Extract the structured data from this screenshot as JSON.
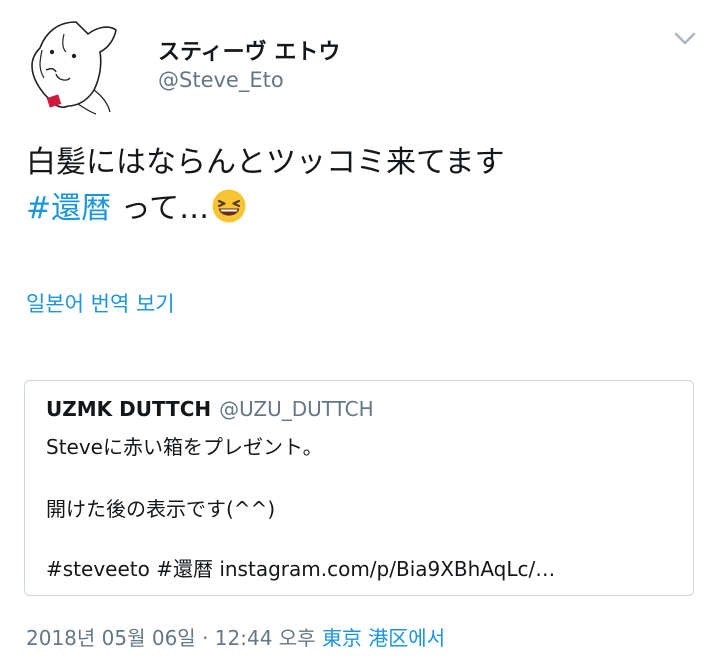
{
  "author": {
    "display_name": "スティーヴ エトウ",
    "handle": "@Steve_Eto",
    "avatar_icon": "dog-sketch-avatar"
  },
  "menu_icon": "chevron-down-icon",
  "tweet": {
    "line1": "白髪にはならんとツッコミ来てます",
    "hashtag": "#還暦",
    "line2_rest": " って…",
    "emoji": "laughing-face-emoji"
  },
  "translate_label": "일본어 번역 보기",
  "quoted_tweet": {
    "name": "UZMK DUTTCH",
    "handle": "@UZU_DUTTCH",
    "line1": "Steveに赤い箱をプレゼント。",
    "line2": "開けた後の表示です(^^)",
    "line3": "#steveeto #還暦 instagram.com/p/Bia9XBhAqLc/…"
  },
  "meta": {
    "timestamp": "2018년 05월 06일 · 12:44 오후 ",
    "location": "東京 港区",
    "location_suffix": "에서"
  },
  "colors": {
    "link": "#1b95e0",
    "secondary_text": "#657786",
    "border": "#ccd6dd",
    "emoji_face": "#f7c533"
  }
}
